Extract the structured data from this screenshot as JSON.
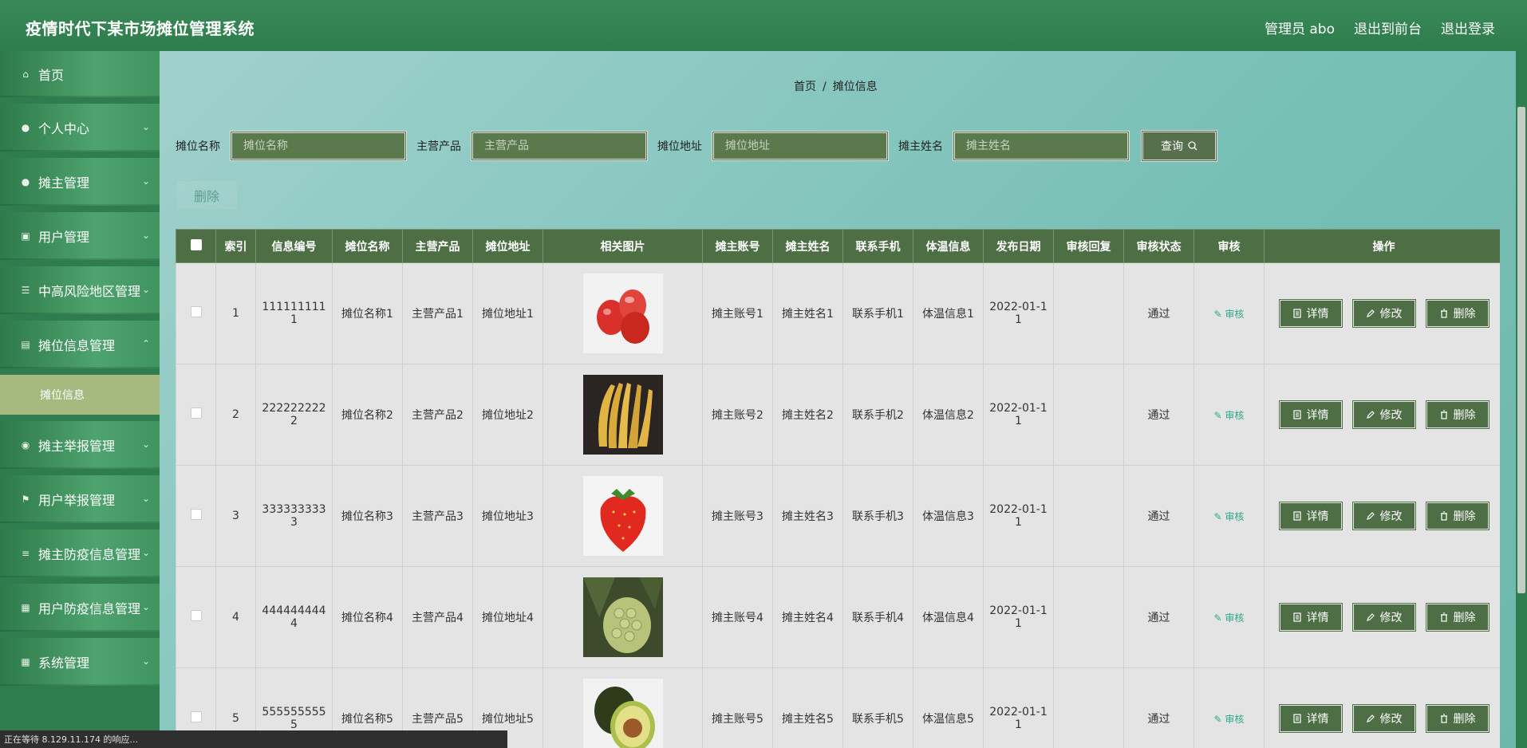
{
  "header": {
    "title": "疫情时代下某市场摊位管理系统",
    "links": [
      "管理员 abo",
      "退出到前台",
      "退出登录"
    ]
  },
  "sidebar": {
    "items": [
      {
        "label": "首页",
        "icon": "home-icon",
        "expandable": false
      },
      {
        "label": "个人中心",
        "icon": "user-icon",
        "expandable": true
      },
      {
        "label": "摊主管理",
        "icon": "user-icon",
        "expandable": true
      },
      {
        "label": "用户管理",
        "icon": "briefcase-icon",
        "expandable": true
      },
      {
        "label": "中高风险地区管理",
        "icon": "menu-icon",
        "expandable": true
      },
      {
        "label": "摊位信息管理",
        "icon": "clipboard-icon",
        "expandable": true,
        "children": [
          "摊位信息"
        ]
      },
      {
        "label": "摊主举报管理",
        "icon": "location-icon",
        "expandable": true
      },
      {
        "label": "用户举报管理",
        "icon": "flag-icon",
        "expandable": true
      },
      {
        "label": "摊主防疫信息管理",
        "icon": "sliders-icon",
        "expandable": true
      },
      {
        "label": "用户防疫信息管理",
        "icon": "grid-icon",
        "expandable": true
      },
      {
        "label": "系统管理",
        "icon": "grid-icon",
        "expandable": true
      }
    ]
  },
  "breadcrumb": {
    "home": "首页",
    "sep": "/",
    "current": "摊位信息"
  },
  "search": {
    "fields": [
      {
        "label": "摊位名称",
        "placeholder": "摊位名称"
      },
      {
        "label": "主营产品",
        "placeholder": "主营产品"
      },
      {
        "label": "摊位地址",
        "placeholder": "摊位地址"
      },
      {
        "label": "摊主姓名",
        "placeholder": "摊主姓名"
      }
    ],
    "query_label": "查询"
  },
  "actions": {
    "delete_label": "删除"
  },
  "table": {
    "headers": [
      "索引",
      "信息编号",
      "摊位名称",
      "主营产品",
      "摊位地址",
      "相关图片",
      "摊主账号",
      "摊主姓名",
      "联系手机",
      "体温信息",
      "发布日期",
      "审核回复",
      "审核状态",
      "审核",
      "操作"
    ],
    "rows": [
      {
        "index": "1",
        "code": "1111111111",
        "name": "摊位名称1",
        "product": "主营产品1",
        "address": "摊位地址1",
        "image": "wax-apple",
        "account": "摊主账号1",
        "owner": "摊主姓名1",
        "phone": "联系手机1",
        "temp": "体温信息1",
        "date": "2022-01-11",
        "reply": "",
        "status": "通过"
      },
      {
        "index": "2",
        "code": "2222222222",
        "name": "摊位名称2",
        "product": "主营产品2",
        "address": "摊位地址2",
        "image": "banana",
        "account": "摊主账号2",
        "owner": "摊主姓名2",
        "phone": "联系手机2",
        "temp": "体温信息2",
        "date": "2022-01-11",
        "reply": "",
        "status": "通过"
      },
      {
        "index": "3",
        "code": "3333333333",
        "name": "摊位名称3",
        "product": "主营产品3",
        "address": "摊位地址3",
        "image": "strawberry",
        "account": "摊主账号3",
        "owner": "摊主姓名3",
        "phone": "联系手机3",
        "temp": "体温信息3",
        "date": "2022-01-11",
        "reply": "",
        "status": "通过"
      },
      {
        "index": "4",
        "code": "4444444444",
        "name": "摊位名称4",
        "product": "主营产品4",
        "address": "摊位地址4",
        "image": "custard-apple",
        "account": "摊主账号4",
        "owner": "摊主姓名4",
        "phone": "联系手机4",
        "temp": "体温信息4",
        "date": "2022-01-11",
        "reply": "",
        "status": "通过"
      },
      {
        "index": "5",
        "code": "5555555555",
        "name": "摊位名称5",
        "product": "主营产品5",
        "address": "摊位地址5",
        "image": "avocado",
        "account": "摊主账号5",
        "owner": "摊主姓名5",
        "phone": "联系手机5",
        "temp": "体温信息5",
        "date": "2022-01-11",
        "reply": "",
        "status": "通过"
      }
    ],
    "audit_label": "审核",
    "op_labels": {
      "detail": "详情",
      "edit": "修改",
      "delete": "删除"
    }
  },
  "status_bar": "正在等待 8.129.11.174 的响应..."
}
